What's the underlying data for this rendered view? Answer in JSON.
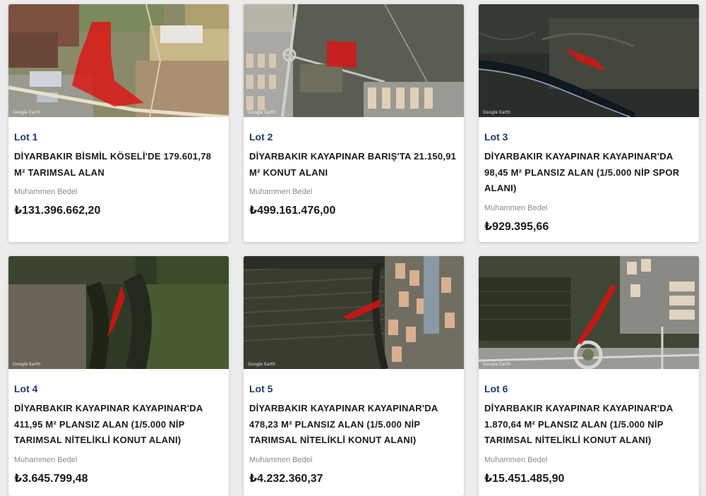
{
  "price_label": "Muhammen Bedel",
  "image_credit": "Google Earth",
  "lots": [
    {
      "lot": "Lot 1",
      "title": "DİYARBAKIR BİSMİL KÖSELİ'DE 179.601,78 M² TARIMSAL ALAN",
      "price_label": "Muhammen Bedel",
      "price": "₺131.396.662,20"
    },
    {
      "lot": "Lot 2",
      "title": "DİYARBAKIR KAYAPINAR BARIŞ'TA 21.150,91 M² KONUT ALANI",
      "price_label": "Muhammen Bedel",
      "price": "₺499.161.476,00"
    },
    {
      "lot": "Lot 3",
      "title": "DİYARBAKIR KAYAPINAR KAYAPINAR'DA 98,45 M² PLANSIZ ALAN (1/5.000 NİP SPOR ALANI)",
      "price_label": "Muhammen Bedel",
      "price": "₺929.395,66"
    },
    {
      "lot": "Lot 4",
      "title": "DİYARBAKIR KAYAPINAR KAYAPINAR'DA 411,95 M² PLANSIZ ALAN (1/5.000 NİP TARIMSAL NİTELİKLİ KONUT ALANI)",
      "price_label": "Muhammen Bedel",
      "price": "₺3.645.799,48"
    },
    {
      "lot": "Lot 5",
      "title": "DİYARBAKIR KAYAPINAR KAYAPINAR'DA 478,23 M² PLANSIZ ALAN (1/5.000 NİP TARIMSAL NİTELİKLİ KONUT ALANI)",
      "price_label": "Muhammen Bedel",
      "price": "₺4.232.360,37"
    },
    {
      "lot": "Lot 6",
      "title": "DİYARBAKIR KAYAPINAR KAYAPINAR'DA 1.870,64 M² PLANSIZ ALAN (1/5.000 NİP TARIMSAL NİTELİKLİ KONUT ALANI)",
      "price_label": "Muhammen Bedel",
      "price": "₺15.451.485,90"
    }
  ],
  "colors": {
    "lot_label": "#1e3a6e",
    "title": "#1a1a1a",
    "muted_label": "#8a8a8a",
    "parcel_highlight": "#e01010",
    "page_background": "#ececec"
  }
}
